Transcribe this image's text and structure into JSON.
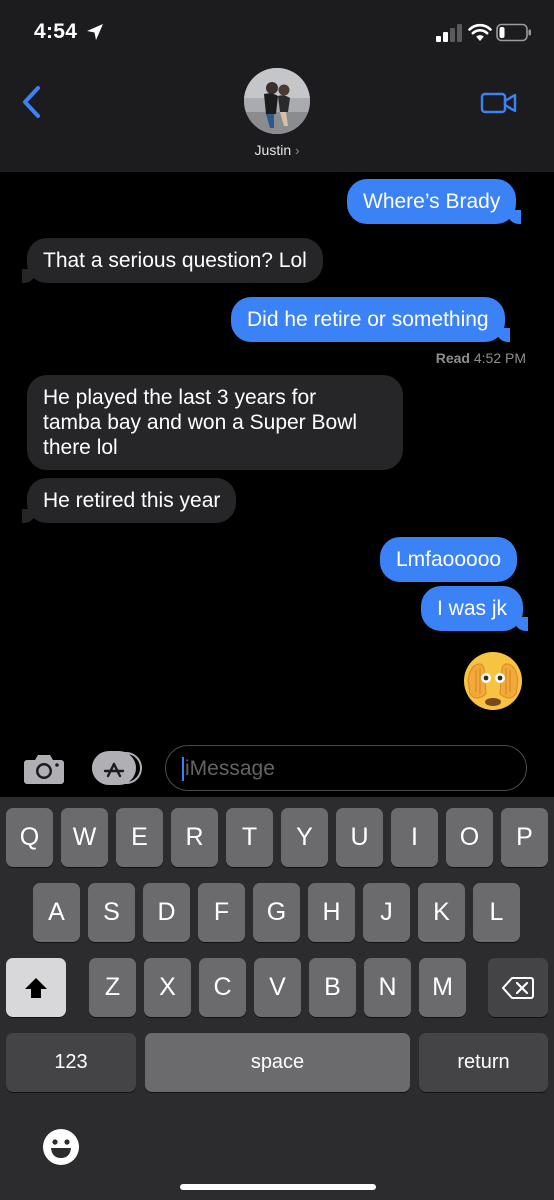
{
  "status_bar": {
    "time": "4:54"
  },
  "header": {
    "contact_name": "Justin",
    "chevron": "›"
  },
  "messages": [
    {
      "dir": "sent",
      "text": "Where’s Brady"
    },
    {
      "dir": "recv",
      "text": "That a serious question? Lol"
    },
    {
      "dir": "sent",
      "text": "Did he retire or something"
    },
    {
      "dir": "recv",
      "lines": [
        "He played the last 3 years for",
        "tamba bay and won a Super Bowl",
        "there lol"
      ]
    },
    {
      "dir": "recv",
      "text": "He retired this year"
    },
    {
      "dir": "sent",
      "text": "Lmfaooooo"
    },
    {
      "dir": "sent",
      "text": "I was jk"
    },
    {
      "dir": "sent",
      "emoji": "see-no-evil-face-emoji"
    }
  ],
  "read_receipt": {
    "label": "Read",
    "time": "4:52 PM"
  },
  "input": {
    "placeholder": "iMessage"
  },
  "keyboard": {
    "row1": [
      "Q",
      "W",
      "E",
      "R",
      "T",
      "Y",
      "U",
      "I",
      "O",
      "P"
    ],
    "row2": [
      "A",
      "S",
      "D",
      "F",
      "G",
      "H",
      "J",
      "K",
      "L"
    ],
    "row3": [
      "Z",
      "X",
      "C",
      "V",
      "B",
      "N",
      "M"
    ],
    "numbers_label": "123",
    "space_label": "space",
    "return_label": "return"
  },
  "colors": {
    "sent_bubble": "#3b82f6",
    "received_bubble": "#262629",
    "background": "#000000"
  }
}
